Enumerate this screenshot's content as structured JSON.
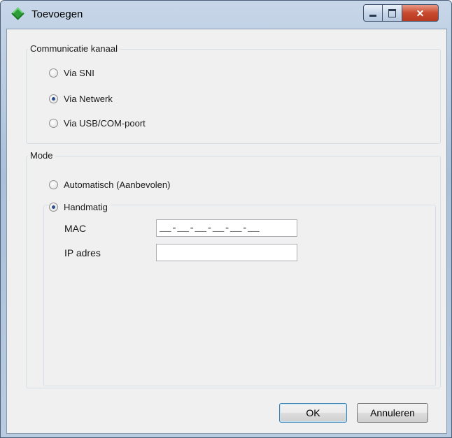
{
  "window": {
    "title": "Toevoegen",
    "icon": "green-diamond-icon",
    "controls": {
      "minimize": "minimize-icon",
      "maximize": "maximize-icon",
      "close": "close-icon"
    }
  },
  "communication": {
    "legend": "Communicatie kanaal",
    "options": [
      {
        "label": "Via SNI",
        "checked": false
      },
      {
        "label": "Via Netwerk",
        "checked": true
      },
      {
        "label": "Via USB/COM-poort",
        "checked": false
      }
    ]
  },
  "mode": {
    "legend": "Mode",
    "options": [
      {
        "label": "Automatisch (Aanbevolen)",
        "checked": false
      },
      {
        "label": "Handmatig",
        "checked": true
      }
    ],
    "fields": {
      "mac_label": "MAC",
      "mac_value": "__-__-__-__-__-__",
      "ip_label": "IP adres",
      "ip_value": ""
    }
  },
  "buttons": {
    "ok": "OK",
    "cancel": "Annuleren"
  }
}
